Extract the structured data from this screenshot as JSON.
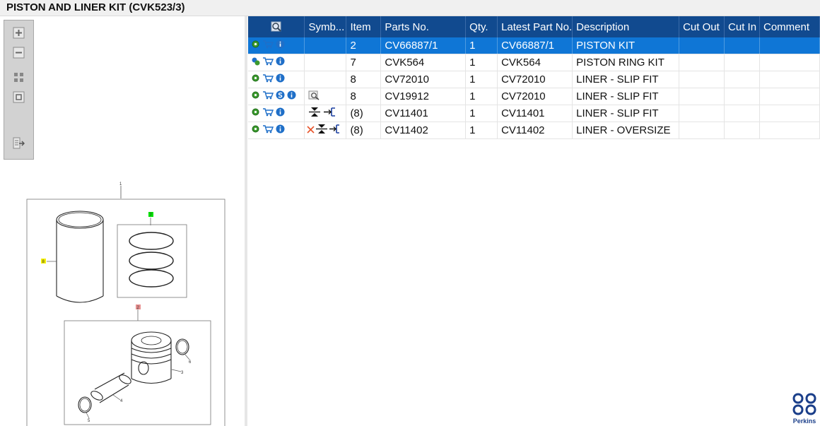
{
  "title": "PISTON AND LINER KIT (CVK523/3)",
  "toolbar": {
    "buttons": [
      "zoom-in",
      "zoom-out",
      "fit-all",
      "fit-page",
      "export"
    ]
  },
  "diagram": {
    "label_kit": "1",
    "label_liner": "8",
    "label_rings": "7",
    "label_piston": "2",
    "label_pin": "4",
    "label_circlip_a": "5",
    "label_circlip_b": "6",
    "label_piston_body": "3"
  },
  "table": {
    "headers": [
      "",
      "Symb...",
      "Item",
      "Parts No.",
      "Qty.",
      "Latest Part No.",
      "Description",
      "Cut Out",
      "Cut In",
      "Comment"
    ],
    "rows": [
      {
        "item": "2",
        "part": "CV66887/1",
        "qty": "1",
        "latest": "CV66887/1",
        "desc": "PISTON KIT",
        "cut_out": "",
        "cut_in": "",
        "comment": ""
      },
      {
        "item": "7",
        "part": "CVK564",
        "qty": "1",
        "latest": "CVK564",
        "desc": "PISTON RING KIT",
        "cut_out": "",
        "cut_in": "",
        "comment": ""
      },
      {
        "item": "8",
        "part": "CV72010",
        "qty": "1",
        "latest": "CV72010",
        "desc": "LINER - SLIP FIT",
        "cut_out": "",
        "cut_in": "",
        "comment": ""
      },
      {
        "item": "8",
        "part": "CV19912",
        "qty": "1",
        "latest": "CV72010",
        "desc": "LINER - SLIP FIT",
        "cut_out": "",
        "cut_in": "",
        "comment": ""
      },
      {
        "item": "(8)",
        "part": "CV11401",
        "qty": "1",
        "latest": "CV11401",
        "desc": "LINER - SLIP FIT",
        "cut_out": "",
        "cut_in": "",
        "comment": ""
      },
      {
        "item": "(8)",
        "part": "CV11402",
        "qty": "1",
        "latest": "CV11402",
        "desc": "LINER - OVERSIZE",
        "cut_out": "",
        "cut_in": "",
        "comment": ""
      }
    ]
  },
  "brand": {
    "name": "Perkins"
  },
  "colors": {
    "header": "#114a8f",
    "selected": "#0f76d6",
    "gear": "#3c9a2e",
    "info": "#1f6fc8",
    "brand": "#1b3f8a"
  }
}
